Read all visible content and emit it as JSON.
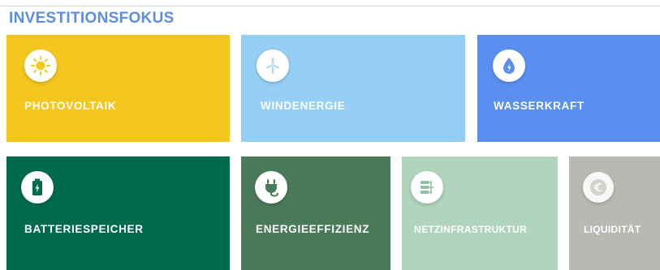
{
  "heading": "INVESTITIONSFOKUS",
  "tiles": [
    {
      "id": "photovoltaik",
      "label": "PHOTOVOLTAIK",
      "color": "#f4c71e",
      "icon": "sun-icon"
    },
    {
      "id": "windenergie",
      "label": "WINDENERGIE",
      "color": "#96cff5",
      "icon": "wind-turbine-icon"
    },
    {
      "id": "wasserkraft",
      "label": "WASSERKRAFT",
      "color": "#5a8ff0",
      "icon": "water-drop-icon"
    },
    {
      "id": "batteriespeicher",
      "label": "BATTERIESPEICHER",
      "color": "#006a4d",
      "icon": "battery-icon"
    },
    {
      "id": "energieeffizienz",
      "label": "ENERGIEEFFIZIENZ",
      "color": "#4a7a5a",
      "icon": "plug-icon"
    },
    {
      "id": "netzinfrastruktur",
      "label": "NETZINFRASTRUKTUR",
      "color": "#b0d4bc",
      "icon": "network-icon"
    },
    {
      "id": "liquiditaet",
      "label": "LIQUIDITÄT",
      "color": "#b9b8b5",
      "icon": "euro-icon"
    }
  ]
}
